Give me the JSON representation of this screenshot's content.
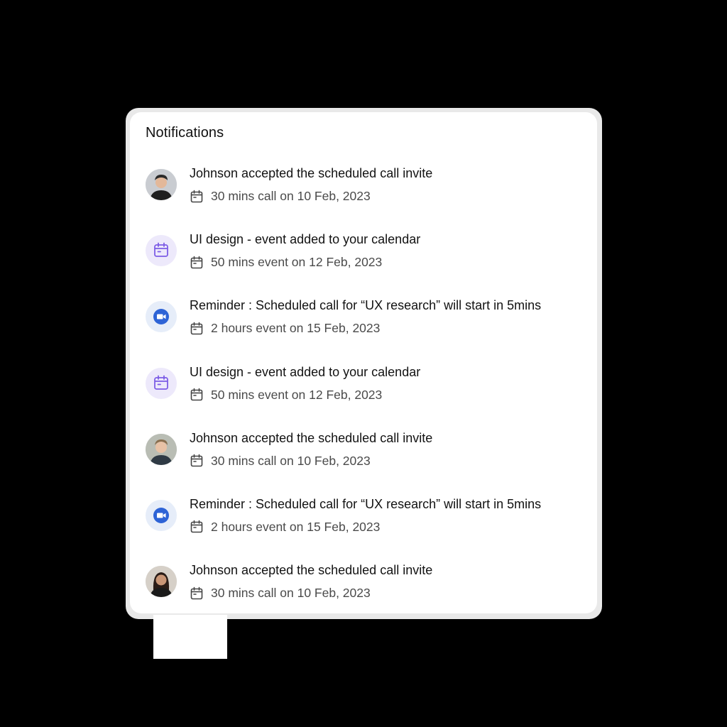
{
  "panel": {
    "title": "Notifications"
  },
  "colors": {
    "purple_badge_bg": "#ede9fb",
    "purple_icon": "#7c5ce6",
    "blue_badge_bg": "#e6edf9",
    "blue_icon": "#2d63d6"
  },
  "notifications": [
    {
      "icon": "user-avatar-man-dark-hair",
      "title": "Johnson accepted the scheduled call invite",
      "meta": "30 mins call on 10 Feb, 2023"
    },
    {
      "icon": "calendar-icon",
      "title": "UI design - event added to your calendar",
      "meta": "50 mins event on 12 Feb, 2023"
    },
    {
      "icon": "video-camera-icon",
      "title": "Reminder : Scheduled call for “UX research” will start in 5mins",
      "meta": "2 hours event on 15 Feb, 2023"
    },
    {
      "icon": "calendar-icon",
      "title": "UI design - event added to your calendar",
      "meta": "50 mins event on 12 Feb, 2023"
    },
    {
      "icon": "user-avatar-man-light-hair",
      "title": "Johnson accepted the scheduled call invite",
      "meta": "30 mins call on 10 Feb, 2023"
    },
    {
      "icon": "video-camera-icon",
      "title": "Reminder : Scheduled call for “UX research” will start in 5mins",
      "meta": "2 hours event on 15 Feb, 2023"
    },
    {
      "icon": "user-avatar-woman",
      "title": "Johnson accepted the scheduled call invite",
      "meta": "30 mins call on 10 Feb, 2023"
    }
  ]
}
